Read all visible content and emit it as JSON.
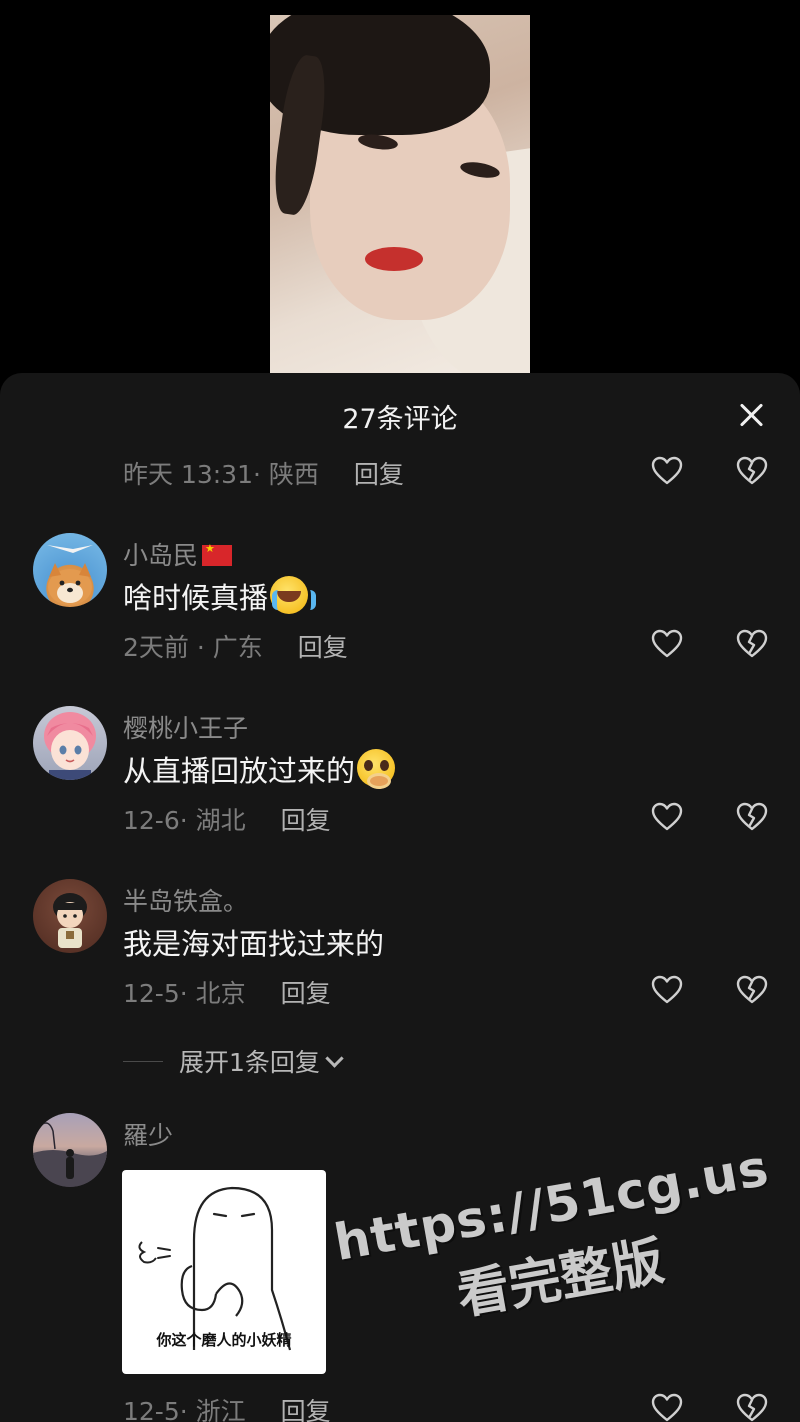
{
  "sheet": {
    "title": "27条评论"
  },
  "comments": [
    {
      "time": "昨天 13:31· 陕西",
      "reply": "回复"
    },
    {
      "username": "小岛民",
      "text": "啥时候真播",
      "emoji": "loudly-crying-face",
      "time": "2天前 · 广东",
      "reply": "回复"
    },
    {
      "username": "樱桃小王子",
      "text": "从直播回放过来的",
      "emoji": "pleading-face",
      "time": "12-6· 湖北",
      "reply": "回复"
    },
    {
      "username": "半岛铁盒。",
      "text": "我是海对面找过来的",
      "time": "12-5· 北京",
      "reply": "回复"
    },
    {
      "username": "羅少",
      "sticker_caption": "你这个磨人的小妖精",
      "time": "12-5· 浙江",
      "reply": "回复"
    }
  ],
  "expand_replies": "展开1条回复",
  "watermark": {
    "line1": "https://51cg.us",
    "line2": "看完整版"
  },
  "colors": {
    "background": "#000000",
    "sheet": "#161616",
    "meta_text": "#7c7c7c",
    "username_text": "#8a8a8a",
    "comment_text": "#f4f4f4"
  }
}
